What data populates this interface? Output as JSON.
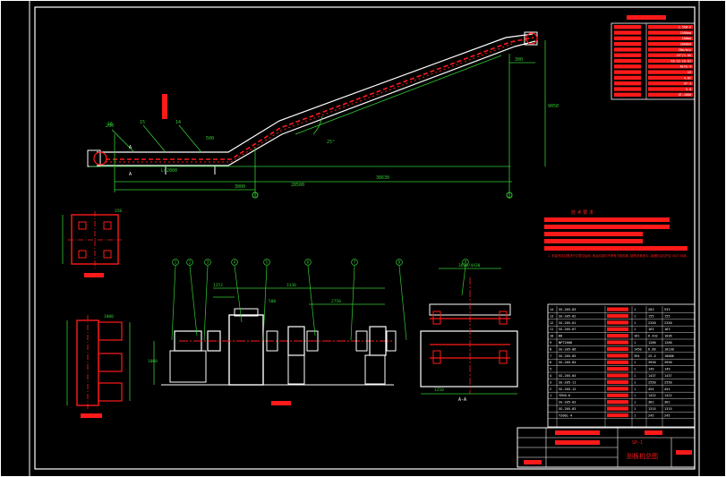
{
  "drawing": {
    "background": "#000000",
    "line_color": "#ffffff",
    "accent_red": "#ff1a1a",
    "dim_green": "#33cc33",
    "title_block_title": "刮板机总图",
    "drawing_number": "SP-1",
    "section_label": "A-A"
  },
  "dimensions": {
    "top_span": "300",
    "bottom_span": "28500",
    "bottom_inner": "38630",
    "lower_length": "L=2800",
    "left_length": "500",
    "bottom_left": "3000",
    "right_height": "9050",
    "incline_mark": "25°",
    "left_tag": "200",
    "drive_overall": "3130",
    "drive_mid": "2750",
    "drive_left": "1253",
    "drive_a": "500",
    "drive_b": "1000",
    "section_top": "3630/4430",
    "section_width": "1250",
    "detail_a_width": "150",
    "detail_b_width": "1000"
  },
  "callouts": {
    "part_numbers": [
      "1",
      "2",
      "3",
      "4",
      "5",
      "6",
      "7",
      "8",
      "9"
    ],
    "detail_marks": [
      "A",
      "A"
    ],
    "left_labels": [
      "16",
      "15",
      "14"
    ]
  },
  "parts_table": {
    "rows": [
      {
        "no": "14",
        "code": "SG-205-03",
        "qty": "1",
        "w1": "203",
        "w2": "533"
      },
      {
        "no": "13",
        "code": "SG-205-02",
        "qty": "1",
        "w1": "155",
        "w2": "155"
      },
      {
        "no": "12",
        "code": "SG-205-01",
        "qty": "1",
        "w1": "2350",
        "w2": "2350"
      },
      {
        "no": "11",
        "code": "SG-205-07",
        "qty": "1",
        "w1": "163",
        "w2": "163"
      },
      {
        "no": "10",
        "code": "B8",
        "qty": "161",
        "w1": "6.432",
        "w2": "1036"
      },
      {
        "no": "9",
        "code": "NPT2000",
        "qty": "1",
        "w1": "1260",
        "w2": "1260"
      },
      {
        "no": "8",
        "code": "SG-205-06",
        "qty": "1450",
        "w1": "6.89",
        "w2": "10130"
      },
      {
        "no": "7",
        "code": "SG-205-05",
        "qty": "394",
        "w1": "25.4",
        "w2": "10006"
      },
      {
        "no": "6",
        "code": "SG-205-04",
        "qty": "1",
        "w1": "3950",
        "w2": "3950"
      },
      {
        "no": "5",
        "code": "",
        "qty": "1",
        "w1": "149",
        "w2": "149"
      },
      {
        "no": "4",
        "code": "SG-205-04",
        "qty": "1",
        "w1": "1437",
        "w2": "1437"
      },
      {
        "no": "3",
        "code": "SG-205-11",
        "qty": "1",
        "w1": "2550",
        "w2": "2550"
      },
      {
        "no": "2",
        "code": "SG-205-12",
        "qty": "1",
        "w1": "454",
        "w2": "454"
      },
      {
        "no": "1",
        "code": "YEK0-6",
        "qty": "1",
        "w1": "1422",
        "w2": "1422"
      },
      {
        "no": "",
        "code": "SG-205-03",
        "qty": "1",
        "w1": "362",
        "w2": "362"
      },
      {
        "no": "",
        "code": "SG-205-03",
        "qty": "1",
        "w1": "1315",
        "w2": "1315"
      },
      {
        "no": "",
        "code": "Y200L-4",
        "qty": "1",
        "w1": "245",
        "w2": "245"
      }
    ]
  },
  "spec_table": {
    "rows": [
      "1.5kW·h",
      "1500mm",
      "100mm",
      "2000mm",
      "20m/min",
      "23°/1.0h",
      "KA-SS-10-01",
      "N1YS-4",
      "25",
      "4.0t",
      "GT-3",
      "3.0",
      "GT-1800"
    ]
  },
  "notes": {
    "title": "技 术 要 求",
    "line": "1. 安装完成后需进行空载试运转, 各运动部件不得有卡阻现象, 链条张紧适中; 减速机油位符合 GB/T 标准。"
  }
}
